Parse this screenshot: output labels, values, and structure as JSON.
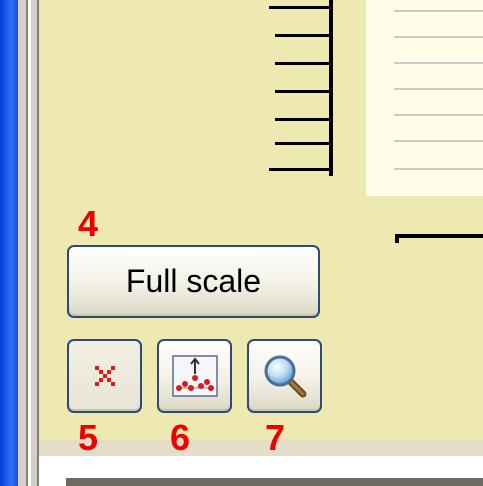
{
  "toolbar": {
    "full_scale_label": "Full scale",
    "clear_icon": "clear-cross-icon",
    "scatter_icon": "scatter-plot-icon",
    "zoom_icon": "magnifier-icon"
  },
  "annotations": {
    "step_4": "4",
    "step_5": "5",
    "step_6": "6",
    "step_7": "7"
  },
  "colors": {
    "panel_background": "#eee8b1",
    "annotation_red": "#ee0000",
    "button_border": "#2c4b7d"
  }
}
